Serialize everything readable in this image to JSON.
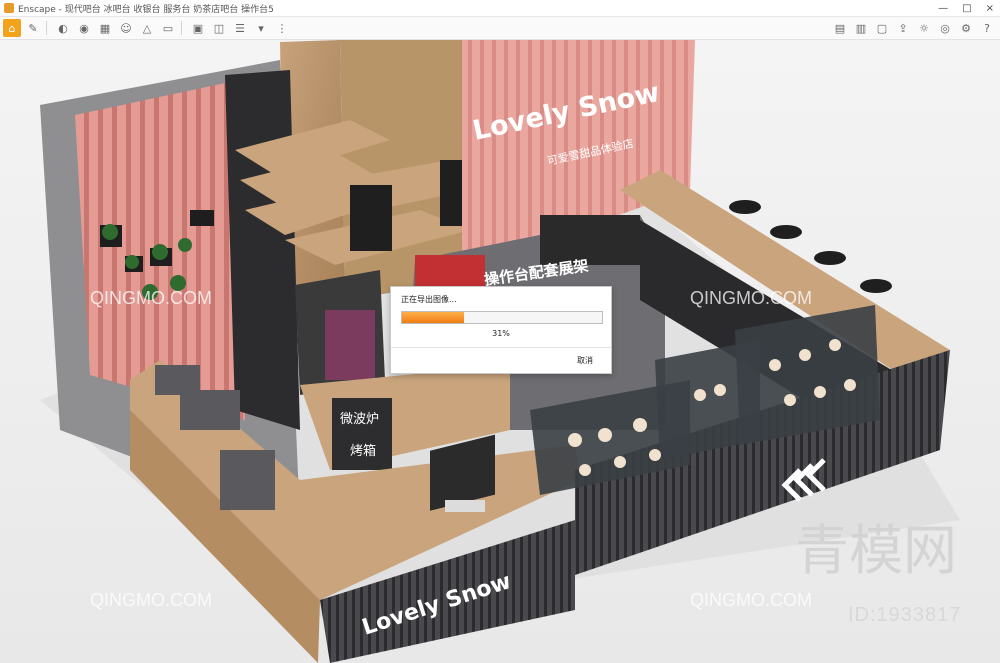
{
  "window": {
    "title": "Enscape - 现代吧台 冰吧台 收银台 服务台 奶茶店吧台 操作台5",
    "controls": [
      "—",
      "□",
      "×"
    ]
  },
  "toolbar": {
    "left_icons": [
      "home-icon",
      "brush-icon",
      "walk-icon",
      "camera-icon",
      "grid-icon",
      "person-icon",
      "measure-icon",
      "video-icon",
      "image-export-icon",
      "panorama-icon",
      "batch-icon",
      "settings-dropdown-icon",
      "more-icon"
    ],
    "right_icons": [
      "map-icon",
      "asset-icon",
      "view-icon",
      "upload-icon",
      "visual-settings-icon",
      "eye-icon",
      "gear-icon",
      "help-icon"
    ]
  },
  "scene": {
    "sign_text": "Lovely Snow",
    "sign_subtitle": "可爱雪甜品体验店",
    "label_mid": "操作台配套展架",
    "label_microwave": "微波炉",
    "label_oven": "烤箱",
    "counter_text": "Lovely Snow"
  },
  "dialog": {
    "message": "正在导出图像...",
    "progress": 0.31,
    "percent_text": "31%",
    "cancel_label": "取消"
  },
  "watermarks": {
    "site": "QINGMO.COM",
    "brand": "青模网",
    "id": "ID:1933817"
  },
  "colors": {
    "accent": "#f4a21c",
    "progress_start": "#ffb04a",
    "progress_end": "#f07d12",
    "pink_wall": "#e08a84",
    "wood": "#c9a47c",
    "dark": "#3b3b3e"
  }
}
